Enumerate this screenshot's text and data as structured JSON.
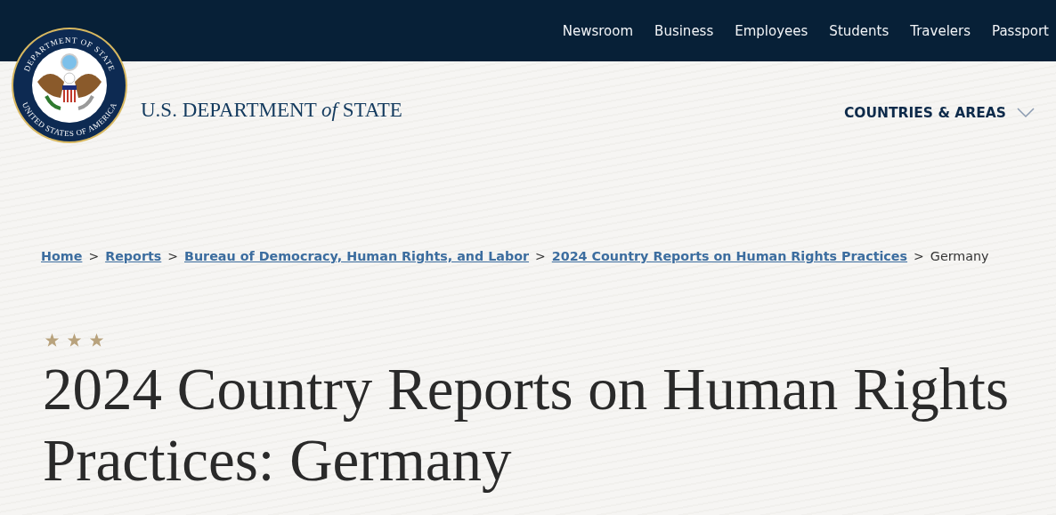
{
  "top_nav": [
    {
      "label": "Newsroom"
    },
    {
      "label": "Business"
    },
    {
      "label": "Employees"
    },
    {
      "label": "Students"
    },
    {
      "label": "Travelers"
    },
    {
      "label": "Passport"
    }
  ],
  "seal": {
    "top_text": "DEPARTMENT OF STATE",
    "bottom_text": "UNITED STATES OF AMERICA"
  },
  "site_title": {
    "before": "U.S. DEPARTMENT",
    "middle": "of",
    "after": "STATE"
  },
  "menu": {
    "label": "COUNTRIES & AREAS",
    "expanded": false
  },
  "breadcrumb": [
    {
      "label": "Home",
      "kind": "link"
    },
    {
      "label": "Reports",
      "kind": "link"
    },
    {
      "label": "Bureau of Democracy, Human Rights, and Labor",
      "kind": "link"
    },
    {
      "label": "2024 Country Reports on Human Rights Practices",
      "kind": "link"
    },
    {
      "label": "Germany",
      "kind": "current"
    }
  ],
  "separator": ">",
  "stars": 3,
  "heading": "2024 Country Reports on Human Rights Practices: Germany"
}
